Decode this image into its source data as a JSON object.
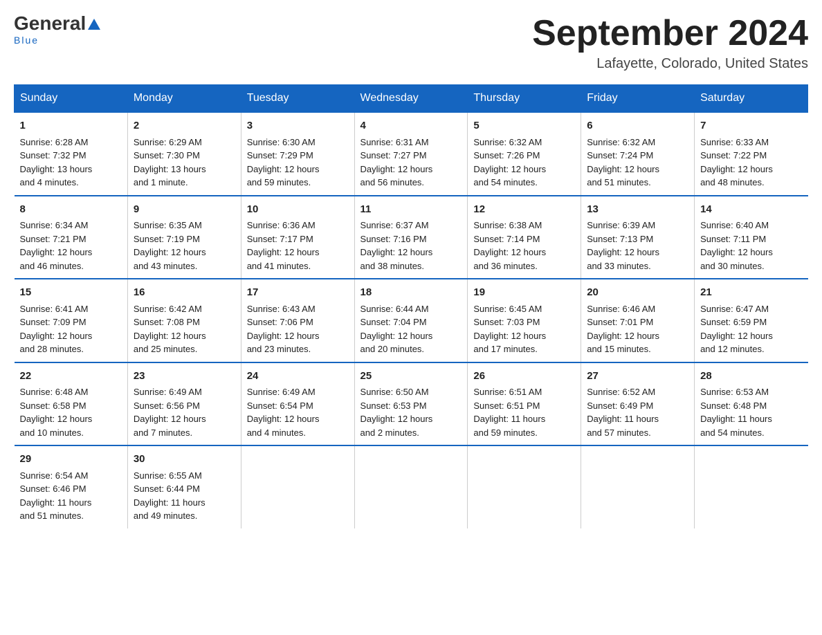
{
  "logo": {
    "general": "General",
    "blue": "Blue",
    "underline": "Blue"
  },
  "title": "September 2024",
  "subtitle": "Lafayette, Colorado, United States",
  "headers": [
    "Sunday",
    "Monday",
    "Tuesday",
    "Wednesday",
    "Thursday",
    "Friday",
    "Saturday"
  ],
  "weeks": [
    [
      {
        "day": "1",
        "lines": [
          "Sunrise: 6:28 AM",
          "Sunset: 7:32 PM",
          "Daylight: 13 hours",
          "and 4 minutes."
        ]
      },
      {
        "day": "2",
        "lines": [
          "Sunrise: 6:29 AM",
          "Sunset: 7:30 PM",
          "Daylight: 13 hours",
          "and 1 minute."
        ]
      },
      {
        "day": "3",
        "lines": [
          "Sunrise: 6:30 AM",
          "Sunset: 7:29 PM",
          "Daylight: 12 hours",
          "and 59 minutes."
        ]
      },
      {
        "day": "4",
        "lines": [
          "Sunrise: 6:31 AM",
          "Sunset: 7:27 PM",
          "Daylight: 12 hours",
          "and 56 minutes."
        ]
      },
      {
        "day": "5",
        "lines": [
          "Sunrise: 6:32 AM",
          "Sunset: 7:26 PM",
          "Daylight: 12 hours",
          "and 54 minutes."
        ]
      },
      {
        "day": "6",
        "lines": [
          "Sunrise: 6:32 AM",
          "Sunset: 7:24 PM",
          "Daylight: 12 hours",
          "and 51 minutes."
        ]
      },
      {
        "day": "7",
        "lines": [
          "Sunrise: 6:33 AM",
          "Sunset: 7:22 PM",
          "Daylight: 12 hours",
          "and 48 minutes."
        ]
      }
    ],
    [
      {
        "day": "8",
        "lines": [
          "Sunrise: 6:34 AM",
          "Sunset: 7:21 PM",
          "Daylight: 12 hours",
          "and 46 minutes."
        ]
      },
      {
        "day": "9",
        "lines": [
          "Sunrise: 6:35 AM",
          "Sunset: 7:19 PM",
          "Daylight: 12 hours",
          "and 43 minutes."
        ]
      },
      {
        "day": "10",
        "lines": [
          "Sunrise: 6:36 AM",
          "Sunset: 7:17 PM",
          "Daylight: 12 hours",
          "and 41 minutes."
        ]
      },
      {
        "day": "11",
        "lines": [
          "Sunrise: 6:37 AM",
          "Sunset: 7:16 PM",
          "Daylight: 12 hours",
          "and 38 minutes."
        ]
      },
      {
        "day": "12",
        "lines": [
          "Sunrise: 6:38 AM",
          "Sunset: 7:14 PM",
          "Daylight: 12 hours",
          "and 36 minutes."
        ]
      },
      {
        "day": "13",
        "lines": [
          "Sunrise: 6:39 AM",
          "Sunset: 7:13 PM",
          "Daylight: 12 hours",
          "and 33 minutes."
        ]
      },
      {
        "day": "14",
        "lines": [
          "Sunrise: 6:40 AM",
          "Sunset: 7:11 PM",
          "Daylight: 12 hours",
          "and 30 minutes."
        ]
      }
    ],
    [
      {
        "day": "15",
        "lines": [
          "Sunrise: 6:41 AM",
          "Sunset: 7:09 PM",
          "Daylight: 12 hours",
          "and 28 minutes."
        ]
      },
      {
        "day": "16",
        "lines": [
          "Sunrise: 6:42 AM",
          "Sunset: 7:08 PM",
          "Daylight: 12 hours",
          "and 25 minutes."
        ]
      },
      {
        "day": "17",
        "lines": [
          "Sunrise: 6:43 AM",
          "Sunset: 7:06 PM",
          "Daylight: 12 hours",
          "and 23 minutes."
        ]
      },
      {
        "day": "18",
        "lines": [
          "Sunrise: 6:44 AM",
          "Sunset: 7:04 PM",
          "Daylight: 12 hours",
          "and 20 minutes."
        ]
      },
      {
        "day": "19",
        "lines": [
          "Sunrise: 6:45 AM",
          "Sunset: 7:03 PM",
          "Daylight: 12 hours",
          "and 17 minutes."
        ]
      },
      {
        "day": "20",
        "lines": [
          "Sunrise: 6:46 AM",
          "Sunset: 7:01 PM",
          "Daylight: 12 hours",
          "and 15 minutes."
        ]
      },
      {
        "day": "21",
        "lines": [
          "Sunrise: 6:47 AM",
          "Sunset: 6:59 PM",
          "Daylight: 12 hours",
          "and 12 minutes."
        ]
      }
    ],
    [
      {
        "day": "22",
        "lines": [
          "Sunrise: 6:48 AM",
          "Sunset: 6:58 PM",
          "Daylight: 12 hours",
          "and 10 minutes."
        ]
      },
      {
        "day": "23",
        "lines": [
          "Sunrise: 6:49 AM",
          "Sunset: 6:56 PM",
          "Daylight: 12 hours",
          "and 7 minutes."
        ]
      },
      {
        "day": "24",
        "lines": [
          "Sunrise: 6:49 AM",
          "Sunset: 6:54 PM",
          "Daylight: 12 hours",
          "and 4 minutes."
        ]
      },
      {
        "day": "25",
        "lines": [
          "Sunrise: 6:50 AM",
          "Sunset: 6:53 PM",
          "Daylight: 12 hours",
          "and 2 minutes."
        ]
      },
      {
        "day": "26",
        "lines": [
          "Sunrise: 6:51 AM",
          "Sunset: 6:51 PM",
          "Daylight: 11 hours",
          "and 59 minutes."
        ]
      },
      {
        "day": "27",
        "lines": [
          "Sunrise: 6:52 AM",
          "Sunset: 6:49 PM",
          "Daylight: 11 hours",
          "and 57 minutes."
        ]
      },
      {
        "day": "28",
        "lines": [
          "Sunrise: 6:53 AM",
          "Sunset: 6:48 PM",
          "Daylight: 11 hours",
          "and 54 minutes."
        ]
      }
    ],
    [
      {
        "day": "29",
        "lines": [
          "Sunrise: 6:54 AM",
          "Sunset: 6:46 PM",
          "Daylight: 11 hours",
          "and 51 minutes."
        ]
      },
      {
        "day": "30",
        "lines": [
          "Sunrise: 6:55 AM",
          "Sunset: 6:44 PM",
          "Daylight: 11 hours",
          "and 49 minutes."
        ]
      },
      {
        "day": "",
        "lines": []
      },
      {
        "day": "",
        "lines": []
      },
      {
        "day": "",
        "lines": []
      },
      {
        "day": "",
        "lines": []
      },
      {
        "day": "",
        "lines": []
      }
    ]
  ]
}
